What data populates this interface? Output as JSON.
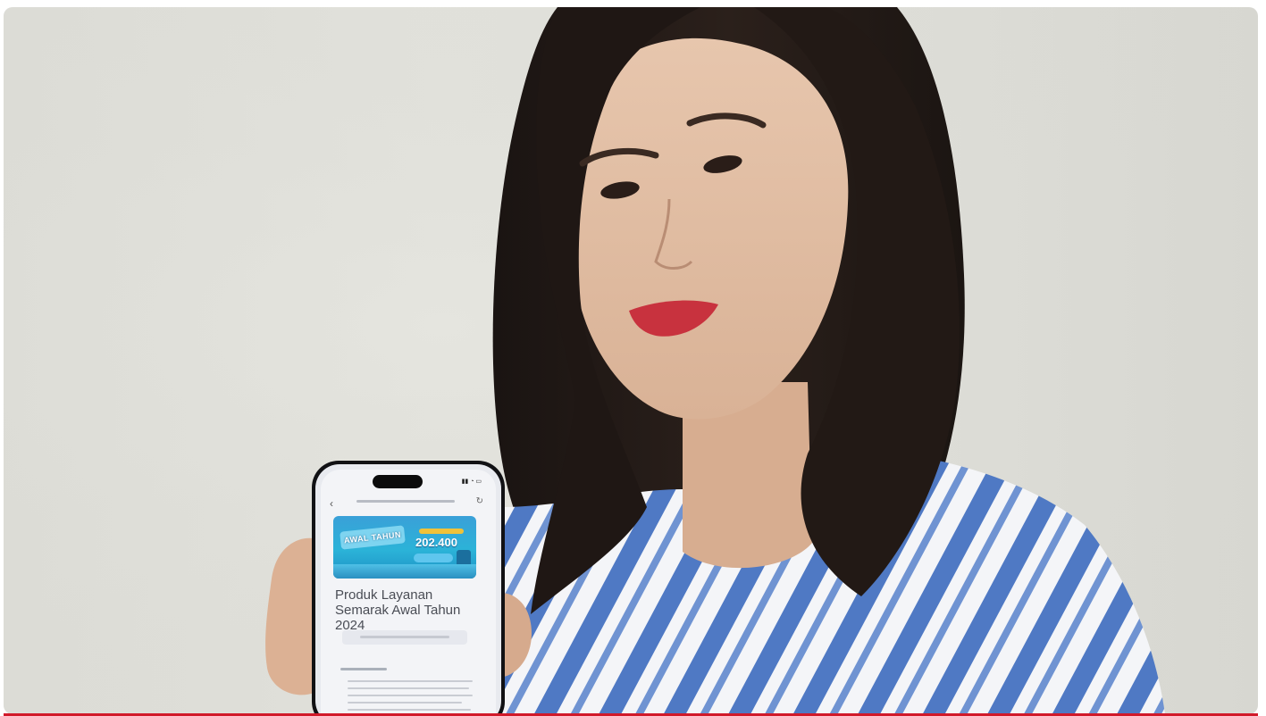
{
  "photo": {
    "subject": "woman-holding-smartphone",
    "background_color": "#dedfd9",
    "shirt_colors": [
      "#f4f5f8",
      "#4f79c4"
    ],
    "accent_line_color": "#d11a2a"
  },
  "phone_screen": {
    "banner": {
      "headline": "AWAL TAHUN",
      "amount": "202.400"
    },
    "article": {
      "title": "Produk Layanan Semarak Awal Tahun 2024"
    }
  }
}
